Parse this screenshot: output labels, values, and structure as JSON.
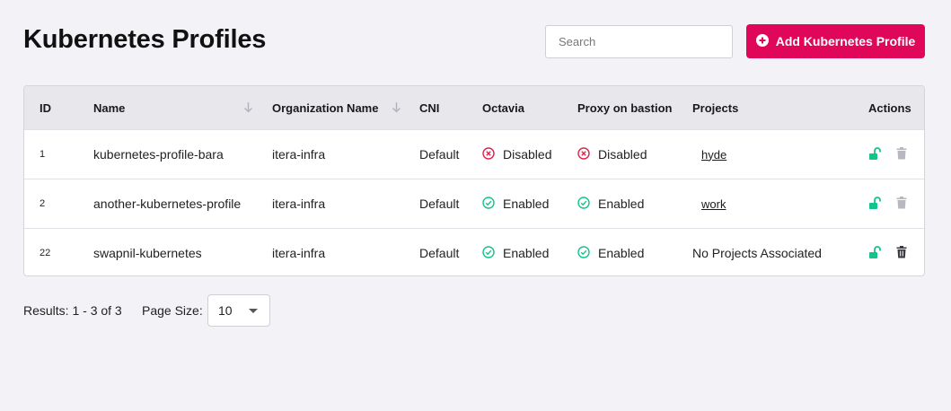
{
  "header": {
    "title": "Kubernetes Profiles",
    "search_placeholder": "Search",
    "add_button_label": "Add Kubernetes Profile"
  },
  "table": {
    "columns": {
      "id": "ID",
      "name": "Name",
      "organization": "Organization Name",
      "cni": "CNI",
      "octavia": "Octavia",
      "proxy": "Proxy on bastion",
      "projects": "Projects",
      "actions": "Actions"
    },
    "rows": [
      {
        "id": "1",
        "name": "kubernetes-profile-bara",
        "organization": "itera-infra",
        "cni": "Default",
        "octavia": "Disabled",
        "proxy": "Disabled",
        "projects": "hyde"
      },
      {
        "id": "2",
        "name": "another-kubernetes-profile",
        "organization": "itera-infra",
        "cni": "Default",
        "octavia": "Enabled",
        "proxy": "Enabled",
        "projects": "work"
      },
      {
        "id": "22",
        "name": "swapnil-kubernetes",
        "organization": "itera-infra",
        "cni": "Default",
        "octavia": "Enabled",
        "proxy": "Enabled",
        "projects": "No Projects Associated"
      }
    ]
  },
  "pagination": {
    "results": "Results: 1 - 3 of 3",
    "page_size_label": "Page Size:",
    "page_size_value": "10"
  },
  "colors": {
    "accent": "#e0075b",
    "enabled": "#12c48b",
    "disabled": "#e0204a",
    "unlock": "#12c48b"
  },
  "icons": {
    "add": "plus-circle-icon",
    "sort": "arrow-down-icon",
    "enabled": "check-circle-icon",
    "disabled": "x-circle-icon",
    "unlock": "unlock-icon",
    "delete": "trash-icon"
  }
}
